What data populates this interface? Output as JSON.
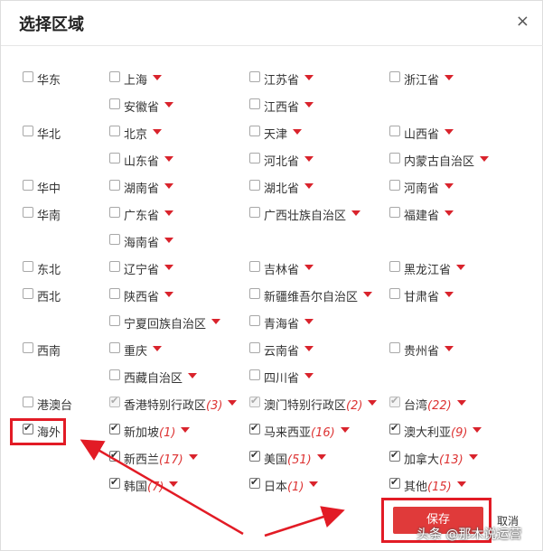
{
  "dialog": {
    "title": "选择区域",
    "close": "×"
  },
  "rows": [
    {
      "region": "华东",
      "provinces": [
        [
          "上海",
          "",
          "江苏省",
          "",
          "浙江省",
          ""
        ],
        [
          "安徽省",
          "",
          "江西省",
          "",
          "",
          ""
        ]
      ]
    },
    {
      "region": "华北",
      "provinces": [
        [
          "北京",
          "",
          "天津",
          "",
          "山西省",
          ""
        ],
        [
          "山东省",
          "",
          "河北省",
          "",
          "内蒙古自治区",
          ""
        ]
      ]
    },
    {
      "region": "华中",
      "provinces": [
        [
          "湖南省",
          "",
          "湖北省",
          "",
          "河南省",
          ""
        ]
      ]
    },
    {
      "region": "华南",
      "provinces": [
        [
          "广东省",
          "",
          "广西壮族自治区",
          "",
          "福建省",
          ""
        ],
        [
          "海南省",
          "",
          "",
          "",
          "",
          ""
        ]
      ]
    },
    {
      "region": "东北",
      "provinces": [
        [
          "辽宁省",
          "",
          "吉林省",
          "",
          "黑龙江省",
          ""
        ]
      ]
    },
    {
      "region": "西北",
      "provinces": [
        [
          "陕西省",
          "",
          "新疆维吾尔自治区",
          "",
          "甘肃省",
          ""
        ],
        [
          "宁夏回族自治区",
          "",
          "青海省",
          "",
          "",
          ""
        ]
      ]
    },
    {
      "region": "西南",
      "provinces": [
        [
          "重庆",
          "",
          "云南省",
          "",
          "贵州省",
          ""
        ],
        [
          "西藏自治区",
          "",
          "四川省",
          "",
          "",
          ""
        ]
      ]
    },
    {
      "region": "港澳台",
      "provinces": [
        [
          "香港特别行政区",
          "(3)",
          "澳门特别行政区",
          "(2)",
          "台湾",
          "(22)"
        ]
      ]
    },
    {
      "region": "海外",
      "provinces": [
        [
          "新加坡",
          "(1)",
          "马来西亚",
          "(16)",
          "澳大利亚",
          "(9)"
        ],
        [
          "新西兰",
          "(17)",
          "美国",
          "(51)",
          "加拿大",
          "(13)"
        ],
        [
          "韩国",
          "(7)",
          "日本",
          "(1)",
          "其他",
          "(15)"
        ]
      ]
    }
  ],
  "buttons": {
    "save": "保存",
    "cancel": "取消"
  },
  "watermark": "头条 @那木说运营",
  "colors": {
    "accent": "#e21b25",
    "button": "#e03a3a",
    "count": "#dd3333"
  }
}
